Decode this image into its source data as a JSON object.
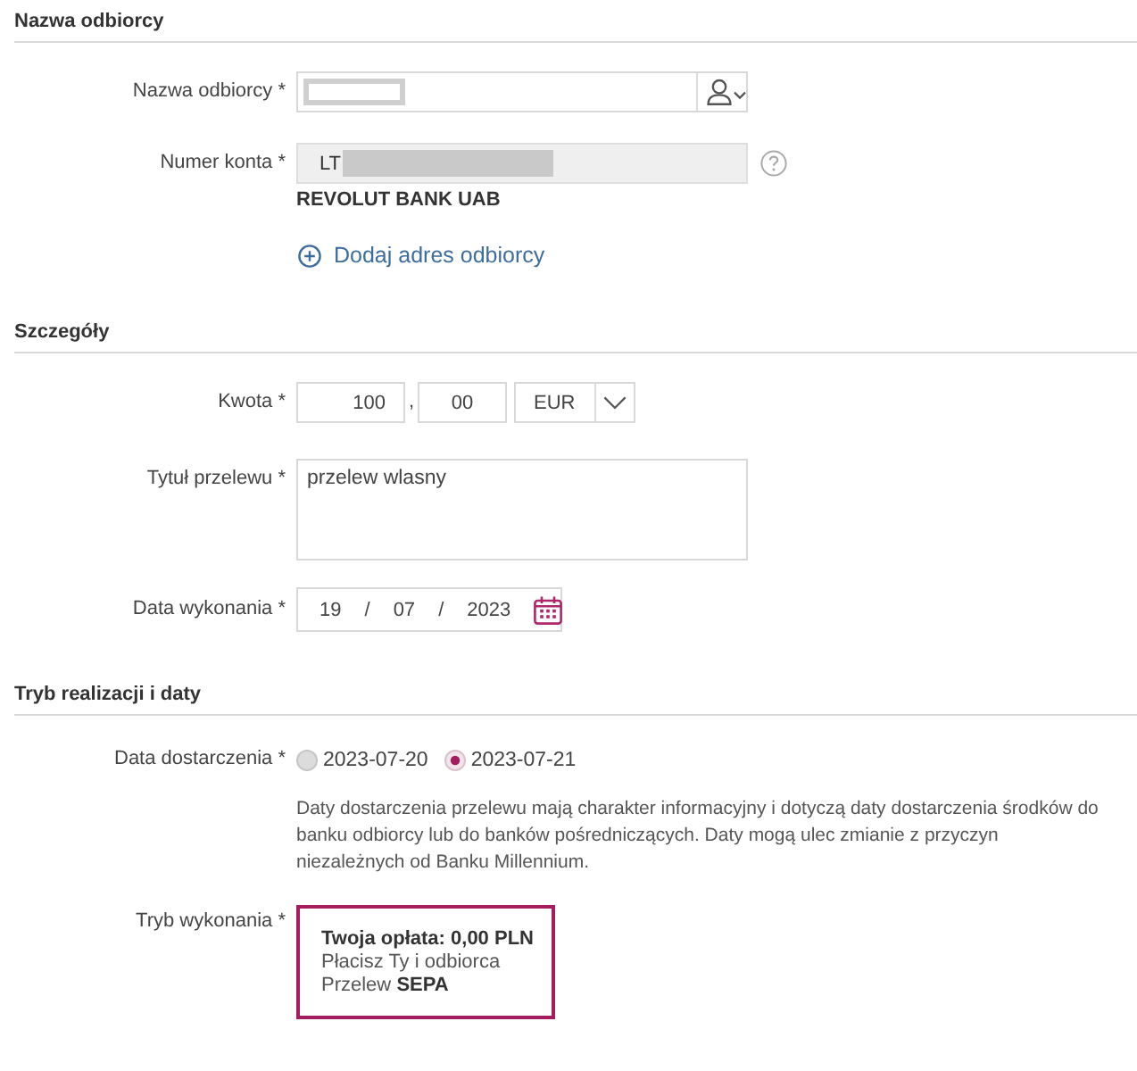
{
  "sections": [
    {
      "title": "Nazwa odbiorcy",
      "rows": [
        {
          "kind": "recipient",
          "label": "Nazwa odbiorcy *",
          "redacted": true
        },
        {
          "kind": "account",
          "label": "Numer konta *",
          "prefix": "LT",
          "redacted": true,
          "help": true
        },
        {
          "kind": "bank_name",
          "text": "REVOLUT BANK UAB"
        },
        {
          "kind": "link",
          "text": "Dodaj adres odbiorcy"
        }
      ]
    },
    {
      "title": "Szczegóły",
      "rows": [
        {
          "kind": "amount",
          "label": "Kwota *",
          "whole": "100",
          "separator": ",",
          "fraction": "00",
          "currency": "EUR"
        },
        {
          "kind": "textarea",
          "label": "Tytuł przelewu *",
          "value": "przelew wlasny"
        },
        {
          "kind": "date",
          "label": "Data wykonania *",
          "parts": [
            "19",
            "07",
            "2023"
          ],
          "separators": [
            "/",
            "/"
          ]
        }
      ]
    },
    {
      "title": "Tryb realizacji i daty",
      "rows": [
        {
          "kind": "radio",
          "label": "Data dostarczenia *",
          "options": [
            {
              "label": "2023-07-20",
              "selected": false
            },
            {
              "label": "2023-07-21",
              "selected": true
            }
          ]
        },
        {
          "kind": "note",
          "text": "Daty dostarczenia przelewu mają charakter informacyjny i dotyczą daty dostarczenia środków do banku odbiorcy lub do banków pośredniczących. Daty mogą ulec zmianie z przyczyn niezależnych od Banku Millennium."
        },
        {
          "kind": "card",
          "label": "Tryb wykonania *",
          "selected": true,
          "lines": [
            {
              "kind": "fee",
              "text": "Twoja opłata: 0,00 PLN"
            },
            {
              "kind": "plain",
              "text": "Płacisz Ty i odbiorca"
            },
            {
              "kind": "plain",
              "text": "Przelew **SEPA**"
            }
          ]
        }
      ]
    }
  ]
}
